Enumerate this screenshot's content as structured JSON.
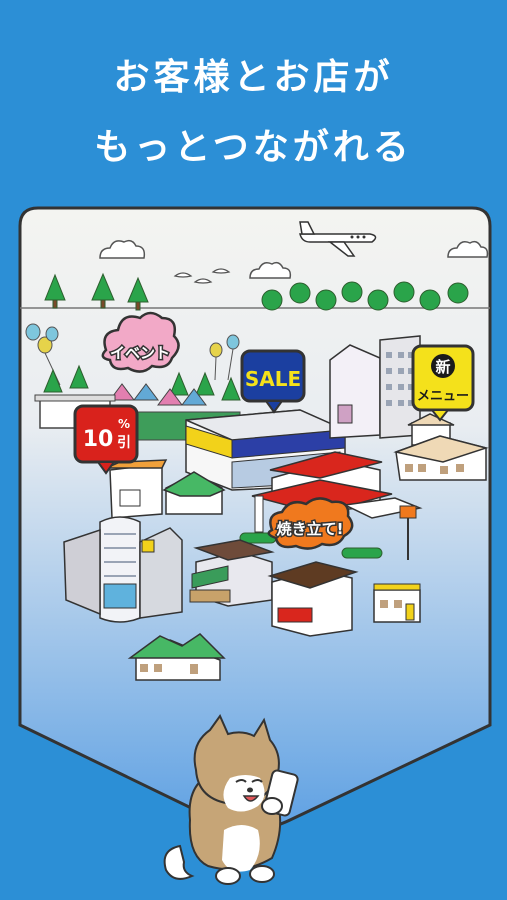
{
  "header": {
    "line1": "お客様とお店が",
    "line2": "もっとつながれる"
  },
  "tags": {
    "event": "イベント",
    "sale": "SALE",
    "discount_value": "10",
    "discount_unit": "%",
    "discount_suffix": "引",
    "new_top": "新",
    "new_bottom": "メニュー",
    "baked": "焼き立て!"
  },
  "colors": {
    "background": "#2c8fd6",
    "panel_top": "#f2f2ef",
    "panel_bottom": "#6aa9e6",
    "sale_tag": "#1b3fa0",
    "discount_tag": "#d9221c",
    "new_tag": "#f4e11b",
    "event_tag": "#f2a9c7",
    "baked_tag": "#f0791e"
  },
  "icons": [
    "airplane-icon",
    "shiba-dog-icon",
    "smartphone-icon",
    "cloud-icon",
    "tree-icon",
    "balloon-icon"
  ]
}
